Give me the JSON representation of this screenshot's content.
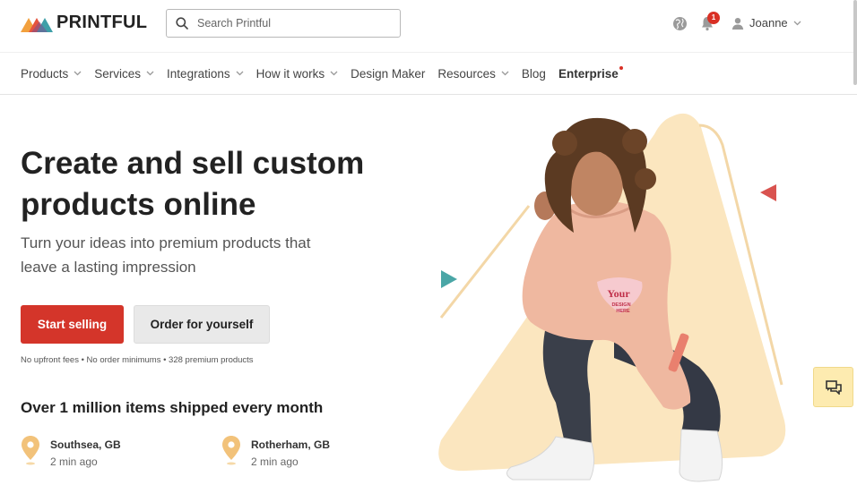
{
  "header": {
    "brand": "PRINTFUL",
    "search_placeholder": "Search Printful",
    "notification_count": "1",
    "user_name": "Joanne"
  },
  "nav": {
    "items": [
      {
        "label": "Products",
        "has_menu": true
      },
      {
        "label": "Services",
        "has_menu": true
      },
      {
        "label": "Integrations",
        "has_menu": true
      },
      {
        "label": "How it works",
        "has_menu": true
      },
      {
        "label": "Design Maker",
        "has_menu": false
      },
      {
        "label": "Resources",
        "has_menu": true
      },
      {
        "label": "Blog",
        "has_menu": false
      },
      {
        "label": "Enterprise",
        "has_menu": false
      }
    ]
  },
  "hero": {
    "title_line1": "Create and sell custom",
    "title_line2": "products online",
    "subtitle_line1": "Turn your ideas into premium products that",
    "subtitle_line2": "leave a lasting impression",
    "primary_cta": "Start selling",
    "secondary_cta": "Order for yourself",
    "fineprint": "No upfront fees • No order minimums • 328 premium products",
    "shipped_heading": "Over 1 million items shipped every month",
    "locations": [
      {
        "city": "Southsea, GB",
        "time": "2 min ago"
      },
      {
        "city": "Rotherham, GB",
        "time": "2 min ago"
      }
    ],
    "garment_print_line1": "Your",
    "garment_print_line2": "DESIGN",
    "garment_print_line3": "HERE"
  },
  "colors": {
    "primary": "#d4352a",
    "accent_teal": "#4aa6a6",
    "accent_red": "#d9534f",
    "shape_cream": "#fbe6bf",
    "pin": "#f2c27a"
  },
  "icons": [
    "search-icon",
    "globe-icon",
    "bell-icon",
    "user-icon",
    "chevron-down-icon",
    "location-pin-icon",
    "chat-icon"
  ]
}
